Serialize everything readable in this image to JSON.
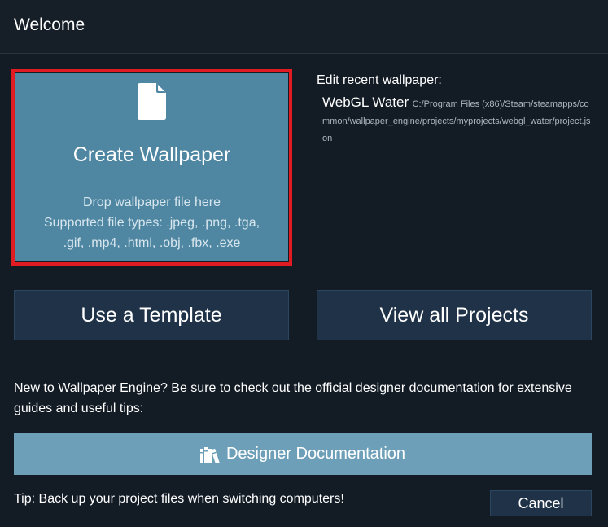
{
  "header": {
    "title": "Welcome"
  },
  "create": {
    "title": "Create Wallpaper",
    "drop_line1": "Drop wallpaper file here",
    "drop_line2": "Supported file types: .jpeg, .png, .tga,",
    "drop_line3": ".gif, .mp4, .html, .obj, .fbx, .exe",
    "icon": "file-icon"
  },
  "recent": {
    "label": "Edit recent wallpaper:",
    "items": [
      {
        "name": "WebGL Water",
        "path": "C:/Program Files (x86)/Steam/steamapps/common/wallpaper_engine/projects/myprojects/webgl_water/project.json"
      }
    ]
  },
  "buttons": {
    "template": "Use a Template",
    "projects": "View all Projects",
    "docs": "Designer Documentation",
    "cancel": "Cancel"
  },
  "info": {
    "docs_text": "New to Wallpaper Engine? Be sure to check out the official designer documentation for extensive guides and useful tips:",
    "tip": "Tip: Back up your project files when switching computers!"
  },
  "colors": {
    "background": "#131b25",
    "create_tile": "#4f87a3",
    "highlight_border": "#e11b22",
    "button": "#1f3247",
    "docs_button": "#6d9fb8"
  }
}
